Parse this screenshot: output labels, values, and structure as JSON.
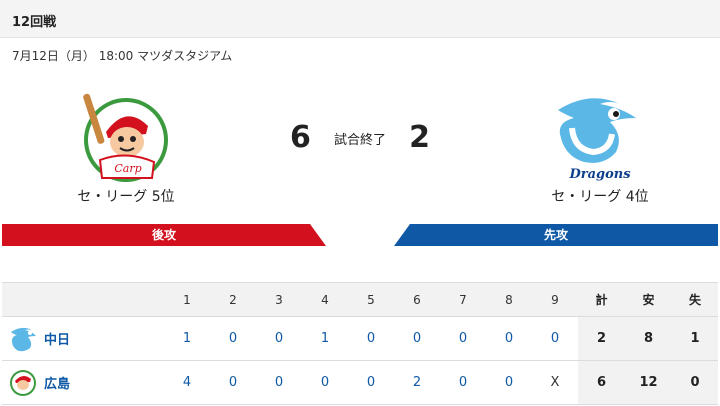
{
  "header": {
    "round": "12回戦"
  },
  "game": {
    "info": "7月12日（月） 18:00 マツダスタジアム",
    "status": "試合終了"
  },
  "home": {
    "name": "広島",
    "rank": "セ・リーグ 5位",
    "side": "後攻",
    "score": "6",
    "logo_text": "Carp"
  },
  "away": {
    "name": "中日",
    "rank": "セ・リーグ 4位",
    "side": "先攻",
    "score": "2",
    "logo_text": "Dragons"
  },
  "scoreboard": {
    "innings": [
      "1",
      "2",
      "3",
      "4",
      "5",
      "6",
      "7",
      "8",
      "9"
    ],
    "total_headers": [
      "計",
      "安",
      "失"
    ],
    "rows": [
      {
        "team": "中日",
        "innings": [
          "1",
          "0",
          "0",
          "1",
          "0",
          "0",
          "0",
          "0",
          "0"
        ],
        "totals": [
          "2",
          "8",
          "1"
        ]
      },
      {
        "team": "広島",
        "innings": [
          "4",
          "0",
          "0",
          "0",
          "0",
          "2",
          "0",
          "0",
          "X"
        ],
        "totals": [
          "6",
          "12",
          "0"
        ]
      }
    ]
  },
  "colors": {
    "home_accent": "#d3111e",
    "away_accent": "#0e58a6",
    "link_blue": "#0e58a6"
  }
}
